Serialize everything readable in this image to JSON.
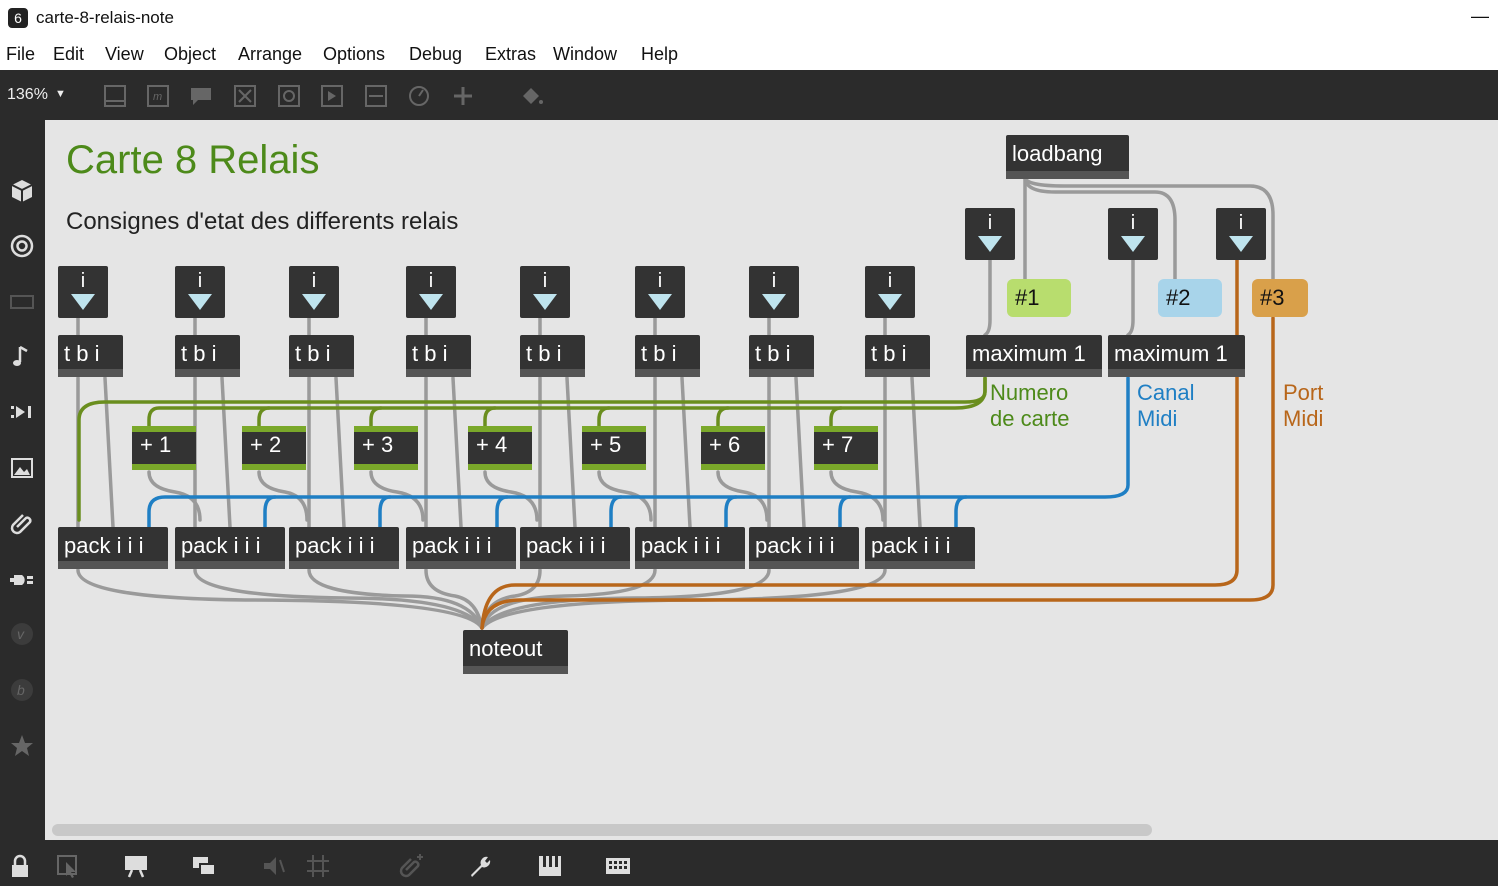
{
  "window": {
    "title": "carte-8-relais-note"
  },
  "menu": [
    "File",
    "Edit",
    "View",
    "Object",
    "Arrange",
    "Options",
    "Debug",
    "Extras",
    "Window",
    "Help"
  ],
  "toolbar": {
    "zoom": "136%"
  },
  "patch": {
    "title": "Carte 8 Relais",
    "subtitle": "Consignes d'etat des differents relais",
    "loadbang": "loadbang",
    "int_label": "i",
    "tbi_label": "t b i",
    "pack_label": "pack i i i",
    "maximum_label": "maximum 1",
    "noteout_label": "noteout",
    "add_labels": [
      "+ 1",
      "+ 2",
      "+ 3",
      "+ 4",
      "+ 5",
      "+ 6",
      "+ 7"
    ],
    "messages": [
      "#1",
      "#2",
      "#3"
    ],
    "comments": {
      "numero": [
        "Numero",
        "de carte"
      ],
      "canal": [
        "Canal",
        "Midi"
      ],
      "port": [
        "Port",
        "Midi"
      ]
    },
    "colors": {
      "title_green": "#4d8a1a",
      "green_wire": "#6a8e1e",
      "blue_wire": "#1f7fc4",
      "orange_wire": "#b8661a",
      "msg1": "#b8dd6e",
      "msg2": "#a8d4ea",
      "msg3": "#d9a04a"
    }
  }
}
